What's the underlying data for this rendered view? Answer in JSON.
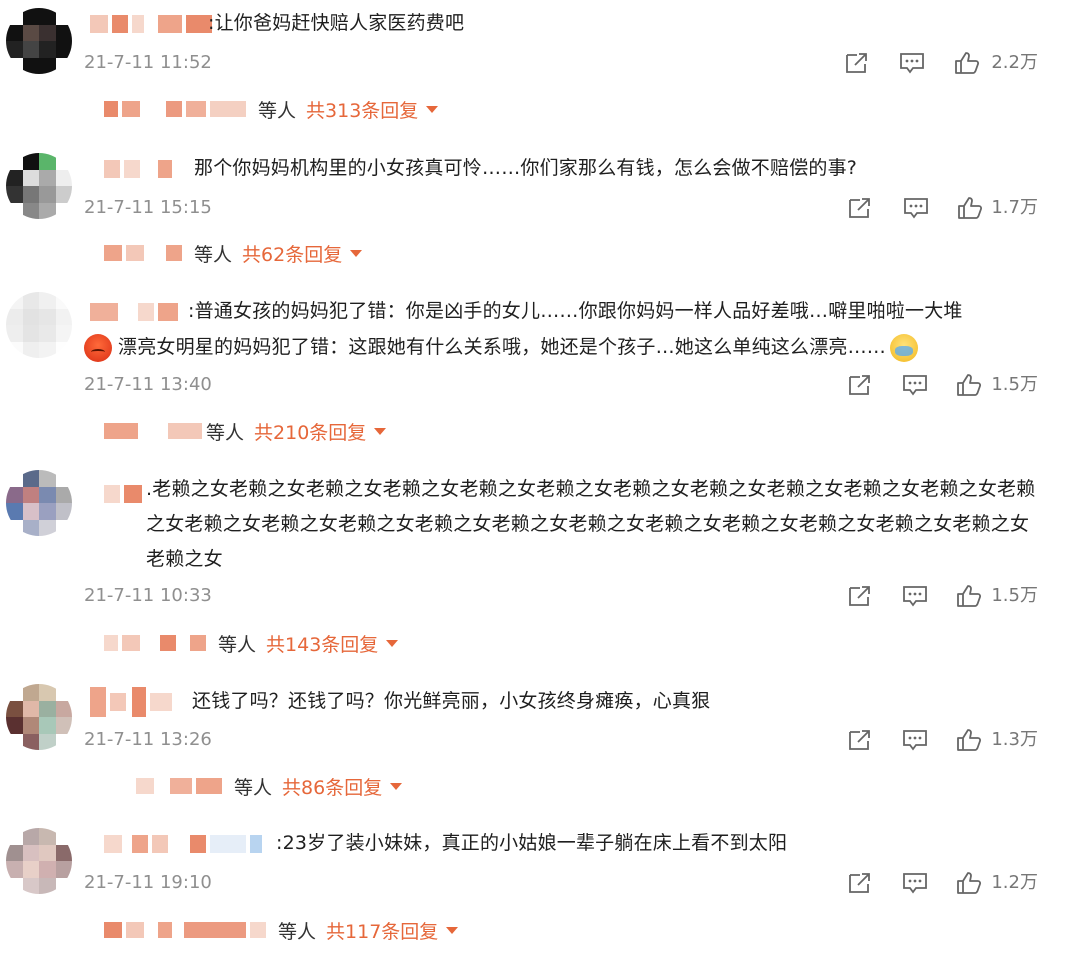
{
  "comments": [
    {
      "text": ":让你爸妈赶快赔人家医药费吧",
      "time": "21-7-11 11:52",
      "likes": "2.2万",
      "replies_by": "等人",
      "replies_total": "共313条回复"
    },
    {
      "text": "那个你妈妈机构里的小女孩真可怜……你们家那么有钱，怎么会做不赔偿的事?",
      "time": "21-7-11 15:15",
      "likes": "1.7万",
      "replies_by": "等人",
      "replies_total": "共62条回复"
    },
    {
      "text_line1": ":普通女孩的妈妈犯了错：你是凶手的女儿……你跟你妈妈一样人品好差哦…噼里啪啦一大堆",
      "text_line2": "漂亮女明星的妈妈犯了错：这跟她有什么关系哦，她还是个孩子…她这么单纯这么漂亮……",
      "time": "21-7-11 13:40",
      "likes": "1.5万",
      "replies_by": "等人",
      "replies_total": "共210条回复"
    },
    {
      "text": ".老赖之女老赖之女老赖之女老赖之女老赖之女老赖之女老赖之女老赖之女老赖之女老赖之女老赖之女老赖之女老赖之女老赖之女老赖之女老赖之女老赖之女老赖之女老赖之女老赖之女老赖之女老赖之女老赖之女老赖之女",
      "time": "21-7-11 10:33",
      "likes": "1.5万",
      "replies_by": "等人",
      "replies_total": "共143条回复"
    },
    {
      "text": "还钱了吗？还钱了吗？你光鲜亮丽，小女孩终身瘫痪，心真狠",
      "time": "21-7-11 13:26",
      "likes": "1.3万",
      "replies_by": "等人",
      "replies_total": "共86条回复"
    },
    {
      "text": ":23岁了装小妹妹，真正的小姑娘一辈子躺在床上看不到太阳",
      "time": "21-7-11 19:10",
      "likes": "1.2万",
      "replies_by": "等人",
      "replies_total": "共117条回复"
    }
  ],
  "icons": [
    "share-icon",
    "comment-icon",
    "like-icon",
    "caret-down-icon",
    "angry-emoji-icon",
    "crying-emoji-icon"
  ],
  "colors": {
    "accent": "#e6673a",
    "text": "#1f1f1f",
    "meta": "#8f8f8f"
  }
}
